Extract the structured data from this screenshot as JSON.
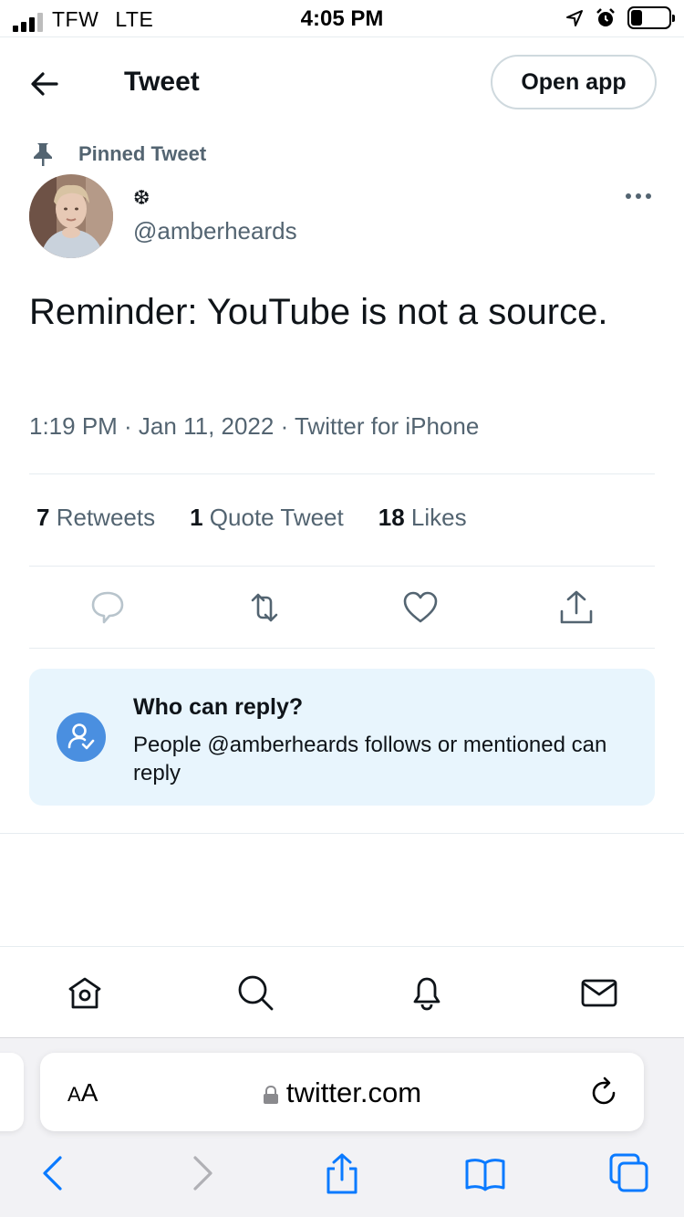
{
  "status_bar": {
    "carrier": "TFW",
    "network": "LTE",
    "time": "4:05 PM"
  },
  "header": {
    "title": "Tweet",
    "open_app_label": "Open app"
  },
  "tweet": {
    "pinned_label": "Pinned Tweet",
    "display_name": "❆",
    "handle": "@amberheards",
    "text": "Reminder: YouTube is not a source.",
    "meta": "1:19 PM · Jan 11, 2022 · Twitter for iPhone",
    "stats": [
      {
        "count": "7",
        "label": "Retweets"
      },
      {
        "count": "1",
        "label": "Quote Tweet"
      },
      {
        "count": "18",
        "label": "Likes"
      }
    ]
  },
  "reply_restriction": {
    "title": "Who can reply?",
    "description": "People @amberheards follows or mentioned can reply"
  },
  "browser": {
    "text_size_label_small": "A",
    "text_size_label_large": "A",
    "url": "twitter.com"
  },
  "colors": {
    "accent": "#1d9bf0",
    "reply_box_bg": "#e8f5fd",
    "secondary_text": "#536471",
    "safari_blue": "#0a7aff"
  }
}
